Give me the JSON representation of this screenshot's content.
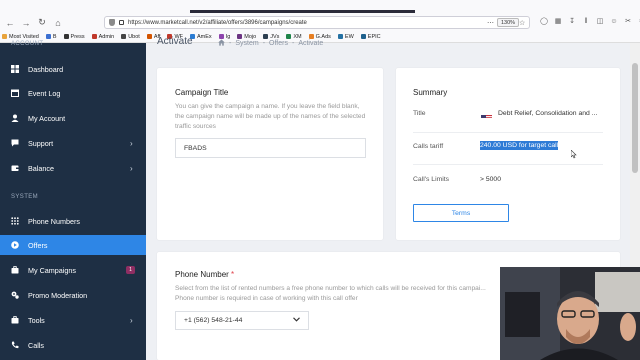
{
  "browser": {
    "url": "https://www.marketcall.net/v2/affiliate/offers/3896/campaigns/create",
    "zoom": "130%",
    "bookmarks": [
      "Most Visited",
      "B",
      "Press",
      "Admin",
      "Ubot",
      "Aff",
      "WF",
      "AmEx",
      "Ig",
      "Mojo",
      "JVs",
      "XM",
      "G.Ads",
      "EW",
      "EPIC"
    ]
  },
  "sidebar": {
    "account_label": "ACCOUNT",
    "system_label": "SYSTEM",
    "items": [
      {
        "label": "Dashboard",
        "icon": "dashboard-icon"
      },
      {
        "label": "Event Log",
        "icon": "calendar-icon"
      },
      {
        "label": "My Account",
        "icon": "user-icon"
      },
      {
        "label": "Support",
        "icon": "support-icon"
      },
      {
        "label": "Balance",
        "icon": "wallet-icon"
      },
      {
        "label": "Phone Numbers",
        "icon": "dialpad-icon"
      },
      {
        "label": "Offers",
        "icon": "play-circle-icon"
      },
      {
        "label": "My Campaigns",
        "icon": "briefcase-icon",
        "badge": "1"
      },
      {
        "label": "Promo Moderation",
        "icon": "gears-icon"
      },
      {
        "label": "Tools",
        "icon": "briefcase-icon"
      },
      {
        "label": "Calls",
        "icon": "phone-icon"
      }
    ]
  },
  "header": {
    "title": "Activate",
    "breadcrumb": [
      "System",
      "Offers",
      "Activate"
    ]
  },
  "campaign": {
    "title": "Campaign Title",
    "description": "You can give the campaign a name. If you leave the field blank, the campaign name will be made up of the names of the selected traffic sources",
    "value": "FBADS"
  },
  "summary": {
    "heading": "Summary",
    "title_label": "Title",
    "title_value": "Debt Relief, Consolidation and ...",
    "tariff_label": "Calls tariff",
    "tariff_value": "240.00 USD for target call",
    "limits_label": "Call's Limits",
    "limits_value": "> 5000",
    "terms_button": "Terms"
  },
  "phone": {
    "title": "Phone Number",
    "required_mark": "*",
    "description": "Select from the list of rented numbers a free phone number to which calls will be received for this campai... Phone number is required in case of working with this call offer",
    "selected": "+1 (562) 548-21-44"
  },
  "colors": {
    "sidebar_bg": "#1e2f44",
    "active_item": "#2e86e6",
    "page_bg": "#eef0f4",
    "accent": "#2e86e6",
    "selection": "#2e7bd6",
    "badge": "#8f2e63",
    "required": "#e0404a"
  }
}
